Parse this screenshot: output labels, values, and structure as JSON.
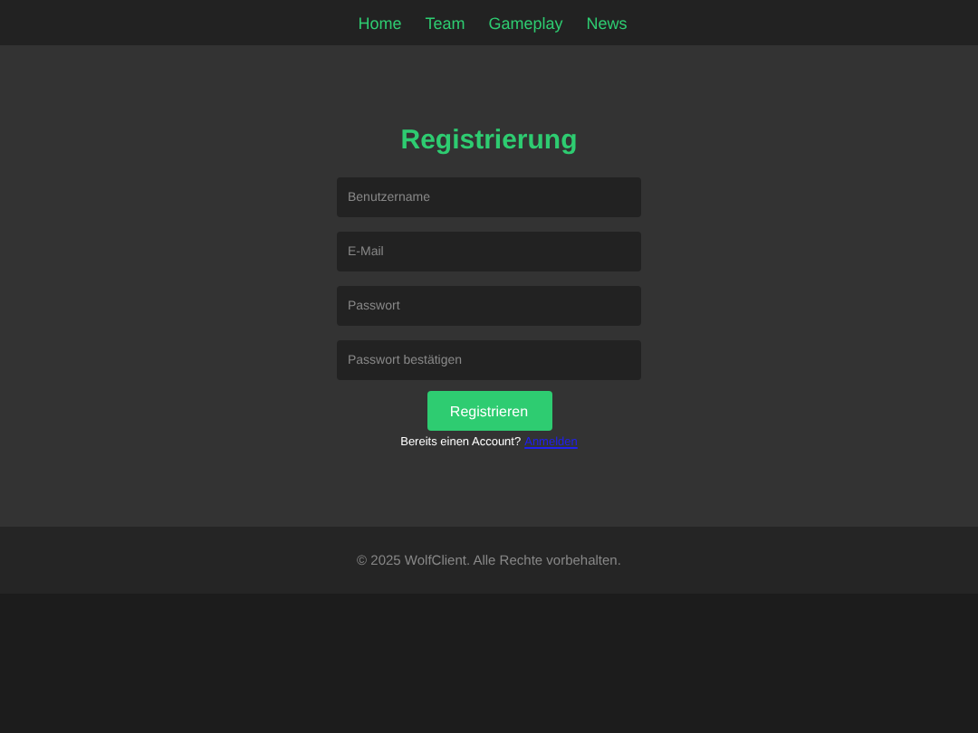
{
  "nav": [
    {
      "label": "Home"
    },
    {
      "label": "Team"
    },
    {
      "label": "Gameplay"
    },
    {
      "label": "News"
    }
  ],
  "form": {
    "title": "Registrierung",
    "fields": [
      {
        "placeholder": "Benutzername"
      },
      {
        "placeholder": "E-Mail"
      },
      {
        "placeholder": "Passwort"
      },
      {
        "placeholder": "Passwort bestätigen"
      }
    ],
    "submit": "Registrieren",
    "prompt": "Bereits einen Account?",
    "link": "Anmelden"
  },
  "footer": "© 2025 WolfClient. Alle Rechte vorbehalten."
}
